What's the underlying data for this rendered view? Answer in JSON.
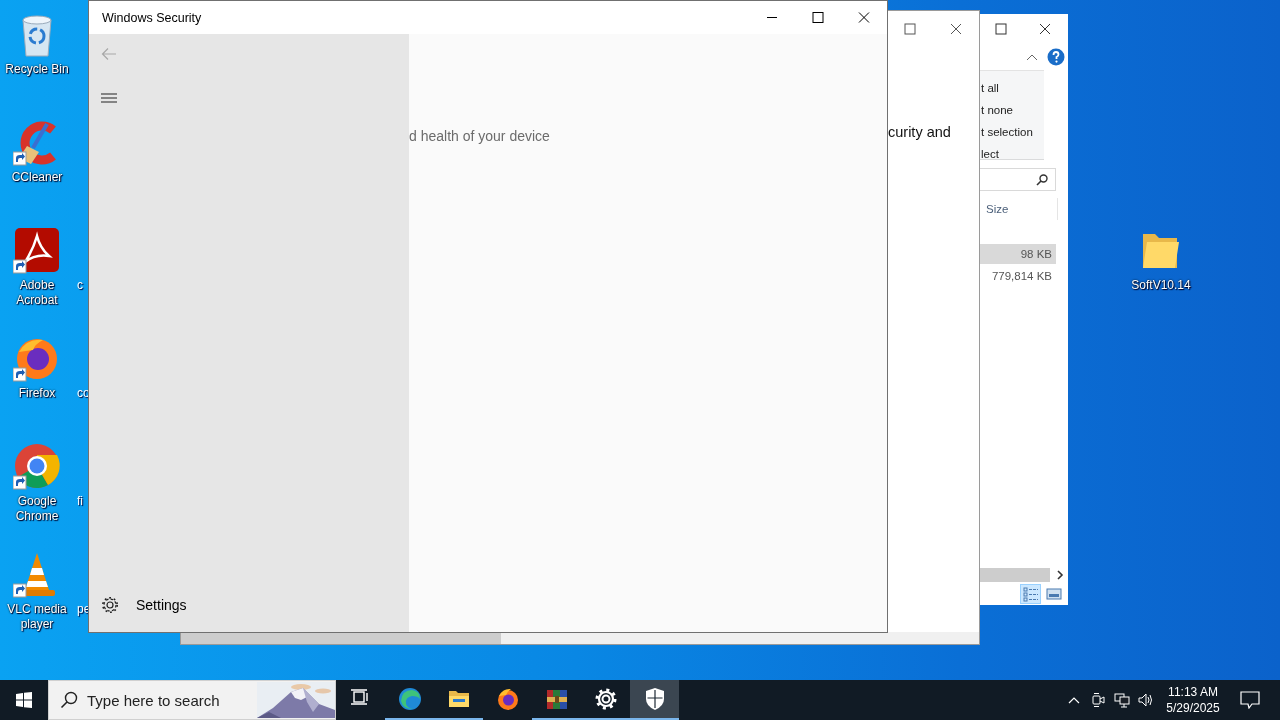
{
  "desktop": {
    "icons": [
      {
        "kind": "recycle-bin",
        "label": "Recycle Bin",
        "shortcut": false
      },
      {
        "kind": "ccleaner",
        "label": "CCleaner",
        "shortcut": true
      },
      {
        "kind": "acrobat",
        "label": "Adobe Acrobat",
        "shortcut": true,
        "column_2_label": "c"
      },
      {
        "kind": "firefox",
        "label": "Firefox",
        "shortcut": true,
        "column_2_label": "co"
      },
      {
        "kind": "chrome",
        "label": "Google Chrome",
        "shortcut": true,
        "column_2_label": "fi"
      },
      {
        "kind": "vlc",
        "label": "VLC media player",
        "shortcut": true,
        "column_2_label": "pe"
      }
    ],
    "right_icons": [
      {
        "kind": "folder",
        "label": "SoftV10.14",
        "shortcut": false
      }
    ]
  },
  "explorer_window": {
    "ribbon_items": [
      "t all",
      "t none",
      "t selection",
      "lect"
    ],
    "column": "Size",
    "rows": [
      {
        "size": "98 KB",
        "selected": true
      },
      {
        "size": "779,814 KB",
        "selected": false
      }
    ],
    "view_buttons": [
      {
        "kind": "details",
        "selected": true
      },
      {
        "kind": "thumbnails",
        "selected": false
      }
    ]
  },
  "background_window": {
    "text": "curity and"
  },
  "security_window": {
    "title": "Windows Security",
    "back_disabled": true,
    "settings_label": "Settings",
    "subtitle": "d health of your device"
  },
  "taskbar": {
    "search_placeholder": "Type here to search",
    "apps": [
      {
        "kind": "task-view",
        "running": false,
        "selected": false
      },
      {
        "kind": "edge",
        "running": true,
        "selected": false
      },
      {
        "kind": "explorer",
        "running": true,
        "selected": false
      },
      {
        "kind": "firefox",
        "running": false,
        "selected": false
      },
      {
        "kind": "winrar",
        "running": true,
        "selected": false
      },
      {
        "kind": "settings",
        "running": true,
        "selected": false
      },
      {
        "kind": "security",
        "running": true,
        "selected": true
      }
    ],
    "time": "11:13 AM",
    "date": "5/29/2025"
  }
}
